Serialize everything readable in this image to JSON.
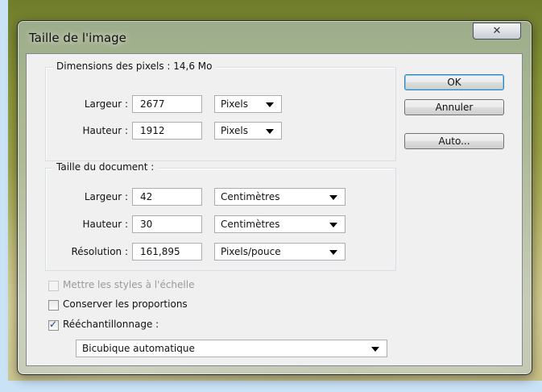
{
  "window": {
    "title": "Taille de l'image",
    "close_glyph": "✕"
  },
  "pixel_dimensions": {
    "legend": "Dimensions des pixels : 14,6 Mo",
    "width": {
      "label": "Largeur :",
      "value": "2677",
      "unit": "Pixels"
    },
    "height": {
      "label": "Hauteur :",
      "value": "1912",
      "unit": "Pixels"
    }
  },
  "document_size": {
    "legend": "Taille du document :",
    "width": {
      "label": "Largeur :",
      "value": "42",
      "unit": "Centimètres"
    },
    "height": {
      "label": "Hauteur :",
      "value": "30",
      "unit": "Centimètres"
    },
    "resolution": {
      "label": "Résolution :",
      "value": "161,895",
      "unit": "Pixels/pouce"
    }
  },
  "buttons": {
    "ok": "OK",
    "cancel": "Annuler",
    "auto": "Auto..."
  },
  "options": {
    "scale_styles": {
      "label": "Mettre les styles à l'échelle",
      "checked": false,
      "enabled": false
    },
    "constrain": {
      "label": "Conserver les proportions",
      "checked": false,
      "enabled": true
    },
    "resample": {
      "label": "Rééchantillonnage :",
      "checked": true,
      "enabled": true
    }
  },
  "resample_method": "Bicubique automatique",
  "check_glyph": "✓"
}
